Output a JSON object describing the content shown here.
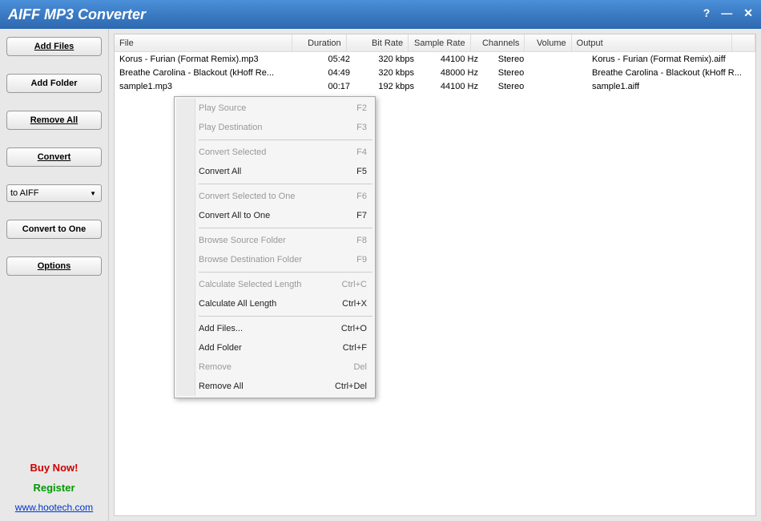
{
  "titlebar": {
    "title": "AIFF MP3 Converter"
  },
  "sidebar": {
    "add_files": "Add Files",
    "add_folder": "Add Folder",
    "remove_all": "Remove All",
    "convert": "Convert",
    "format_select": "to AIFF",
    "convert_to_one": "Convert to One",
    "options": "Options",
    "buy_now": "Buy Now!",
    "register": "Register",
    "website": "www.hootech.com"
  },
  "columns": {
    "file": "File",
    "duration": "Duration",
    "bitrate": "Bit Rate",
    "sample": "Sample Rate",
    "channels": "Channels",
    "volume": "Volume",
    "output": "Output"
  },
  "rows": [
    {
      "file": "Korus - Furian (Format Remix).mp3",
      "duration": "05:42",
      "bitrate": "320 kbps",
      "sample": "44100 Hz",
      "channels": "Stereo",
      "volume": "",
      "output": "Korus - Furian (Format Remix).aiff"
    },
    {
      "file": "Breathe Carolina - Blackout (kHoff Re...",
      "duration": "04:49",
      "bitrate": "320 kbps",
      "sample": "48000 Hz",
      "channels": "Stereo",
      "volume": "",
      "output": "Breathe Carolina - Blackout (kHoff R..."
    },
    {
      "file": "sample1.mp3",
      "duration": "00:17",
      "bitrate": "192 kbps",
      "sample": "44100 Hz",
      "channels": "Stereo",
      "volume": "",
      "output": "sample1.aiff"
    }
  ],
  "menu": [
    {
      "label": "Play Source",
      "shortcut": "F2",
      "disabled": true
    },
    {
      "label": "Play Destination",
      "shortcut": "F3",
      "disabled": true
    },
    {
      "sep": true
    },
    {
      "label": "Convert Selected",
      "shortcut": "F4",
      "disabled": true
    },
    {
      "label": "Convert All",
      "shortcut": "F5",
      "disabled": false
    },
    {
      "sep": true
    },
    {
      "label": "Convert Selected to One",
      "shortcut": "F6",
      "disabled": true
    },
    {
      "label": "Convert All to One",
      "shortcut": "F7",
      "disabled": false
    },
    {
      "sep": true
    },
    {
      "label": "Browse Source Folder",
      "shortcut": "F8",
      "disabled": true
    },
    {
      "label": "Browse Destination Folder",
      "shortcut": "F9",
      "disabled": true
    },
    {
      "sep": true
    },
    {
      "label": "Calculate Selected Length",
      "shortcut": "Ctrl+C",
      "disabled": true
    },
    {
      "label": "Calculate All Length",
      "shortcut": "Ctrl+X",
      "disabled": false
    },
    {
      "sep": true
    },
    {
      "label": "Add Files...",
      "shortcut": "Ctrl+O",
      "disabled": false
    },
    {
      "label": "Add Folder",
      "shortcut": "Ctrl+F",
      "disabled": false
    },
    {
      "label": "Remove",
      "shortcut": "Del",
      "disabled": true
    },
    {
      "label": "Remove All",
      "shortcut": "Ctrl+Del",
      "disabled": false
    }
  ]
}
